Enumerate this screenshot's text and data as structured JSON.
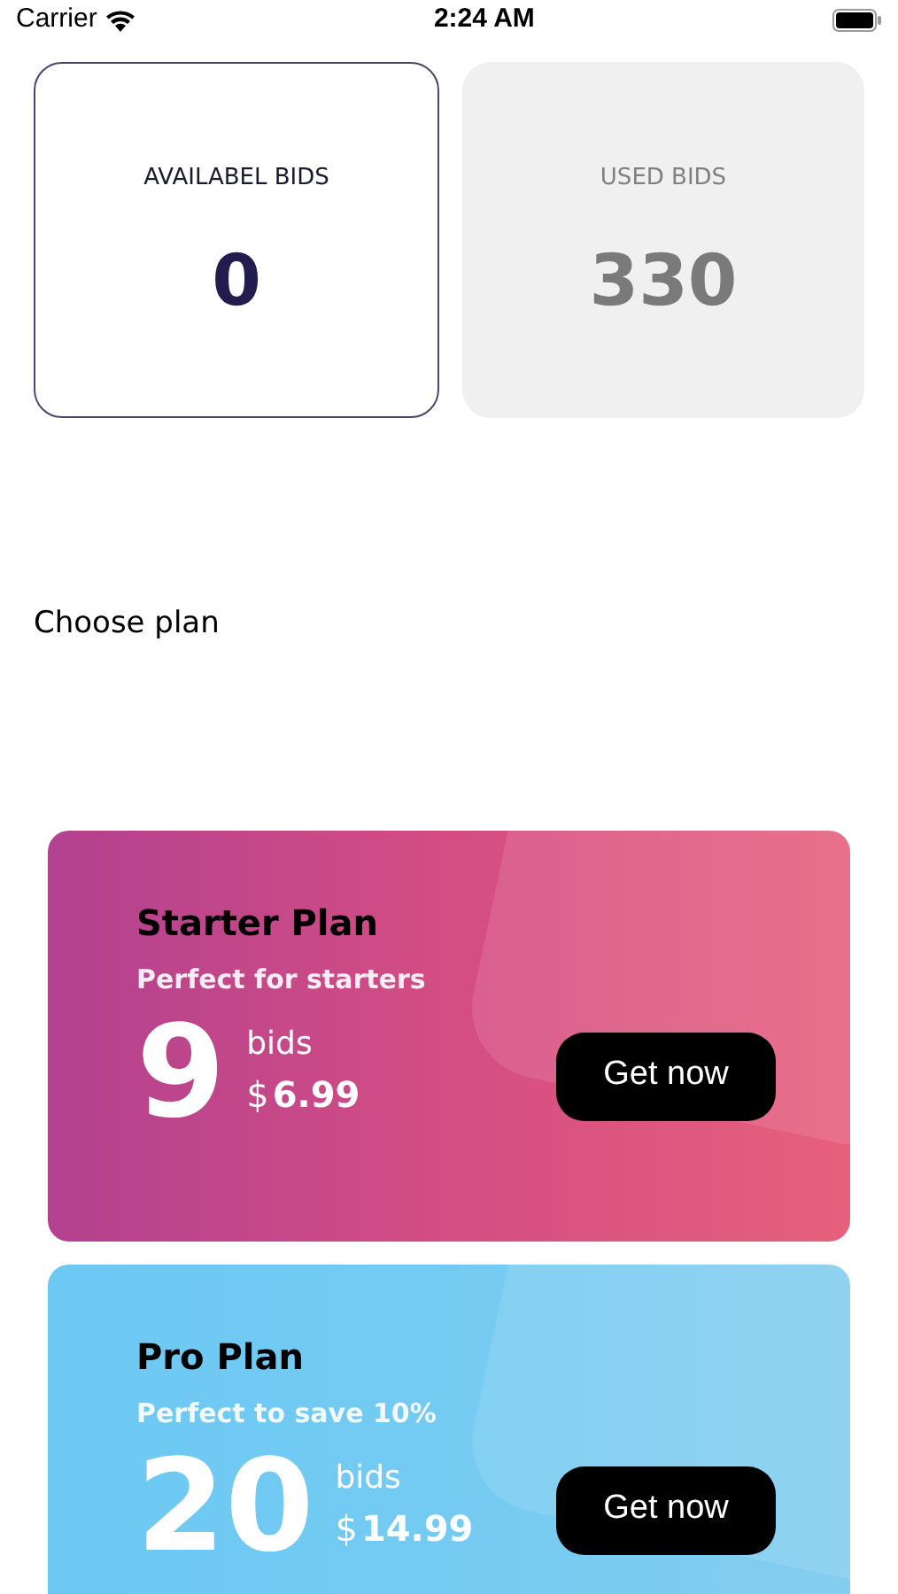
{
  "status_bar": {
    "carrier": "Carrier",
    "time": "2:24 AM"
  },
  "stats": [
    {
      "label": "AVAILABEL BIDS",
      "value": "0",
      "selected": true
    },
    {
      "label": "USED BIDS",
      "value": "330",
      "selected": false
    }
  ],
  "section_title": "Choose plan",
  "plans": [
    {
      "kind": "pink",
      "name": "Starter Plan",
      "tagline": "Perfect for starters",
      "count": "9",
      "unit": "bids",
      "currency": "$",
      "price": "6.99",
      "button": "Get now"
    },
    {
      "kind": "blue",
      "name": "Pro Plan",
      "tagline": "Perfect to save 10%",
      "count": "20",
      "unit": "bids",
      "currency": "$",
      "price": "14.99",
      "button": "Get now"
    }
  ]
}
